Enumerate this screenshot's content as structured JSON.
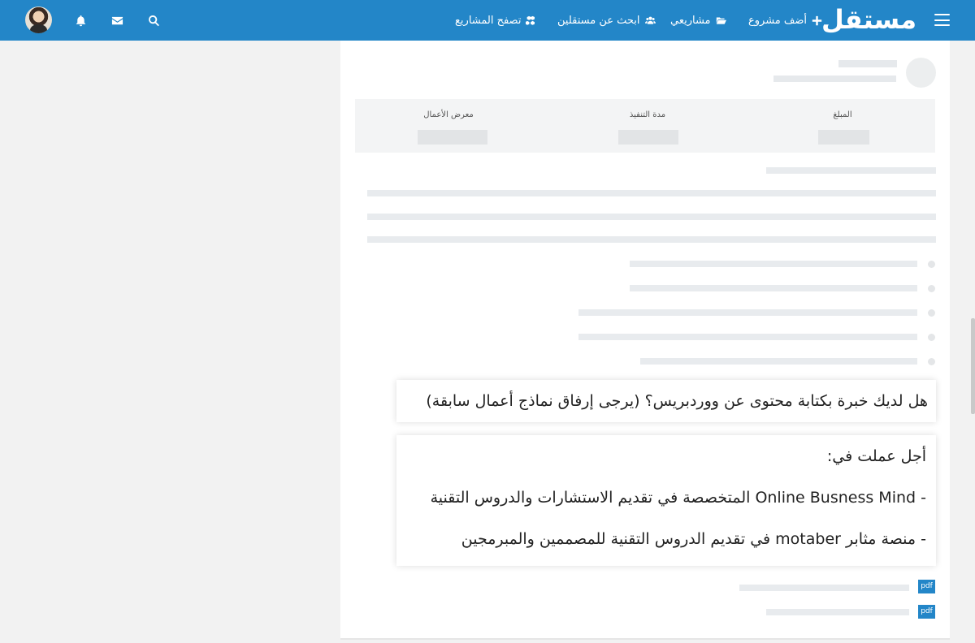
{
  "nav": {
    "logo": "مستقل",
    "items": [
      {
        "label": "أضف مشروع",
        "icon": "plus-icon"
      },
      {
        "label": "مشاريعي",
        "icon": "folder-open-icon"
      },
      {
        "label": "ابحث عن مستقلين",
        "icon": "users-icon"
      },
      {
        "label": "تصفح المشاريع",
        "icon": "cubes-icon"
      }
    ],
    "icons": [
      "search-icon",
      "envelope-icon",
      "bell-icon"
    ]
  },
  "project": {
    "meta": {
      "budget_label": "المبلغ",
      "duration_label": "مدة التنفيذ",
      "portfolio_label": "معرض الأعمال"
    }
  },
  "question": {
    "text": "هل لديك خبرة بكتابة محتوى عن ووردبريس؟ (يرجى إرفاق نماذج أعمال سابقة)"
  },
  "answer": {
    "intro": "أجل عملت في:",
    "line1": "- Online Busness Mind المتخصصة في تقديم الاستشارات والدروس التقنية",
    "line2": "- منصة مثابر motaber في تقديم الدروس التقنية للمصممين والمبرمجين"
  },
  "attachments": [
    {
      "type": "pdf"
    },
    {
      "type": "pdf"
    }
  ]
}
